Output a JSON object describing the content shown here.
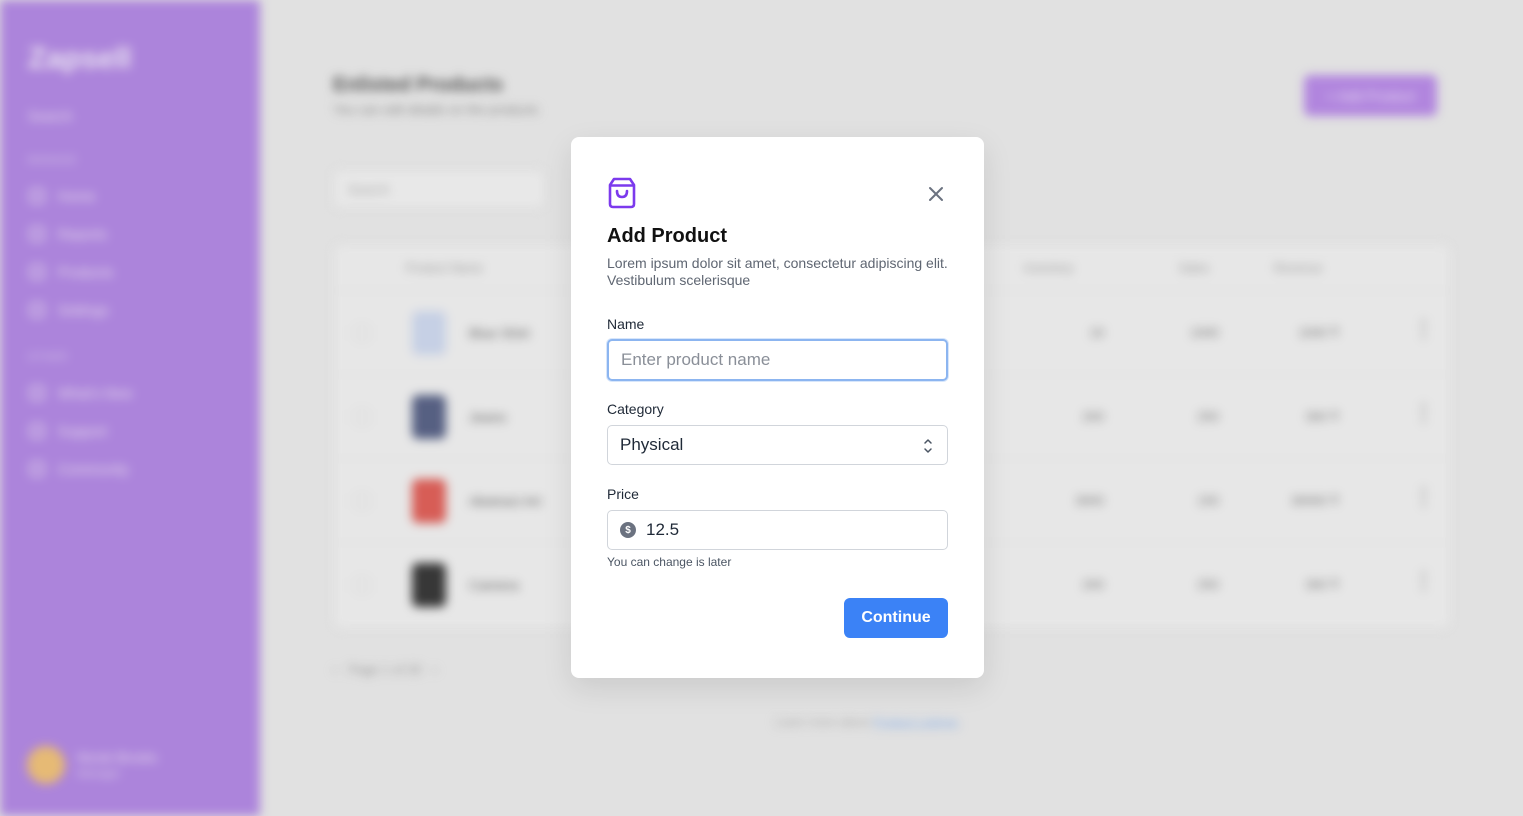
{
  "background": {
    "sidebar": {
      "logo": "Zapsell",
      "search_label": "Search",
      "section_main": "MANAGE",
      "items": [
        {
          "label": "Home"
        },
        {
          "label": "Reports"
        },
        {
          "label": "Products"
        },
        {
          "label": "Settings"
        }
      ],
      "section_other": "OTHER",
      "other_items": [
        {
          "label": "What's New"
        },
        {
          "label": "Support"
        },
        {
          "label": "Community"
        }
      ],
      "user": {
        "name": "Nicole Brooks",
        "role": "Manager"
      }
    },
    "main": {
      "title": "Enlisted Products",
      "subtitle": "You can edit details on the products",
      "add_button": "+ Add Product",
      "search_placeholder": "Search",
      "columns": [
        "Product Name",
        "Inventory",
        "Sales",
        "Revenue"
      ],
      "rows": [
        {
          "name": "Blue Shirt",
          "inventory": "19",
          "sales": "1000",
          "revenue": "1000 ₹",
          "thumb_color": "#cfd9ef"
        },
        {
          "name": "Jeans",
          "inventory": "200",
          "sales": "250",
          "revenue": "300 ₹",
          "thumb_color": "#5a6488"
        },
        {
          "name": "Abstract Art",
          "inventory": "3000",
          "sales": "150",
          "revenue": "30000 ₹",
          "thumb_color": "#e0615a"
        },
        {
          "name": "Camera",
          "inventory": "200",
          "sales": "250",
          "revenue": "300 ₹",
          "thumb_color": "#3a3a3a"
        }
      ],
      "pager": "Page 1 of 20",
      "footer_text": "Learn more about",
      "footer_link": "Product Listings"
    }
  },
  "modal": {
    "title": "Add Product",
    "description": "Lorem ipsum dolor sit amet, consectetur adipiscing elit. Vestibulum scelerisque",
    "name_label": "Name",
    "name_placeholder": "Enter product name",
    "name_value": "",
    "category_label": "Category",
    "category_value": "Physical",
    "price_label": "Price",
    "price_value": "12.5",
    "price_currency_symbol": "$",
    "price_helper": "You can change is later",
    "continue_label": "Continue",
    "accent_color": "#7c3aed",
    "primary_button_color": "#3b82f6"
  }
}
